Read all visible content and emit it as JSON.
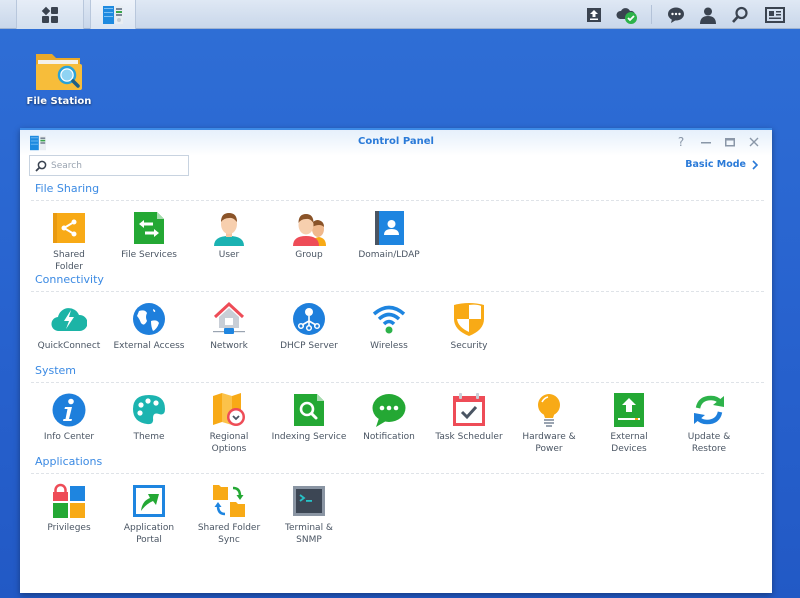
{
  "taskbar": {
    "main_menu_icon": "grid-icon",
    "open_app_icon": "control-panel-icon",
    "right_icons": [
      "upload-icon",
      "cloud-check-icon",
      "chat-icon",
      "user-icon",
      "search-icon",
      "widgets-icon"
    ]
  },
  "desktop": {
    "icons": [
      {
        "label": "File Station",
        "icon": "folder-search-icon"
      }
    ]
  },
  "window": {
    "title": "Control Panel",
    "controls": [
      "help",
      "minimize",
      "maximize",
      "close"
    ],
    "search": {
      "placeholder": "Search",
      "value": ""
    },
    "mode_link": "Basic Mode",
    "sections": [
      {
        "title": "File Sharing",
        "items": [
          {
            "label": "Shared\nFolder",
            "icon": "shared-folder-icon"
          },
          {
            "label": "File Services",
            "icon": "file-services-icon"
          },
          {
            "label": "User",
            "icon": "user-icon"
          },
          {
            "label": "Group",
            "icon": "group-icon"
          },
          {
            "label": "Domain/LDAP",
            "icon": "domain-ldap-icon"
          }
        ]
      },
      {
        "title": "Connectivity",
        "items": [
          {
            "label": "QuickConnect",
            "icon": "quickconnect-icon"
          },
          {
            "label": "External Access",
            "icon": "globe-icon"
          },
          {
            "label": "Network",
            "icon": "network-house-icon"
          },
          {
            "label": "DHCP Server",
            "icon": "dhcp-icon"
          },
          {
            "label": "Wireless",
            "icon": "wifi-icon"
          },
          {
            "label": "Security",
            "icon": "shield-icon"
          }
        ]
      },
      {
        "title": "System",
        "items": [
          {
            "label": "Info Center",
            "icon": "info-icon"
          },
          {
            "label": "Theme",
            "icon": "palette-icon"
          },
          {
            "label": "Regional\nOptions",
            "icon": "map-clock-icon"
          },
          {
            "label": "Indexing Service",
            "icon": "indexing-icon"
          },
          {
            "label": "Notification",
            "icon": "notification-bubble-icon"
          },
          {
            "label": "Task Scheduler",
            "icon": "calendar-check-icon"
          },
          {
            "label": "Hardware &\nPower",
            "icon": "lightbulb-icon"
          },
          {
            "label": "External\nDevices",
            "icon": "external-device-icon"
          },
          {
            "label": "Update &\nRestore",
            "icon": "update-arrows-icon"
          }
        ]
      },
      {
        "title": "Applications",
        "items": [
          {
            "label": "Privileges",
            "icon": "privileges-icon"
          },
          {
            "label": "Application\nPortal",
            "icon": "app-portal-icon"
          },
          {
            "label": "Shared Folder\nSync",
            "icon": "folder-sync-icon"
          },
          {
            "label": "Terminal &\nSNMP",
            "icon": "terminal-icon"
          }
        ]
      }
    ]
  },
  "colors": {
    "desktop": "#2a66d0",
    "accent": "#3b8ae3"
  }
}
